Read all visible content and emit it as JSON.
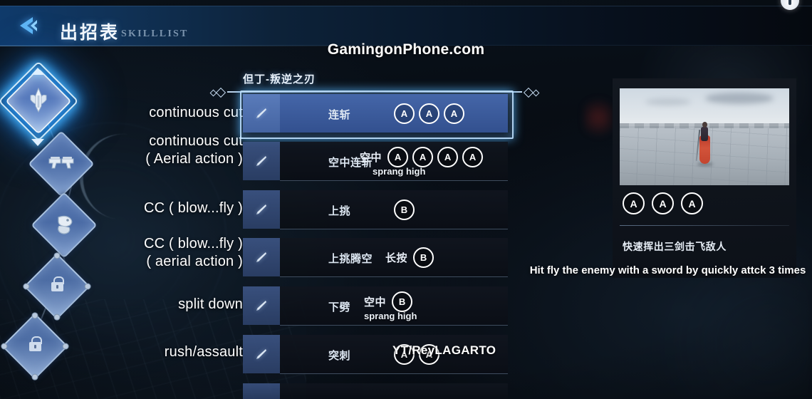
{
  "header": {
    "back_icon": "back-chevron-icon",
    "title_cn": "出招表",
    "title_en": "SKILLLIST",
    "corner_icon": "circle-info-icon"
  },
  "watermark": {
    "site": "GamingonPhone.com",
    "channel": "YT/ReyLAGARTO"
  },
  "weapon_rail": {
    "items": [
      {
        "name": "sword-weapon-icon",
        "state": "selected",
        "locked": false
      },
      {
        "name": "dual-pistols-weapon-icon",
        "state": "normal",
        "locked": false
      },
      {
        "name": "gauntlet-weapon-icon",
        "state": "normal",
        "locked": false
      },
      {
        "name": "locked-weapon-slot-icon",
        "state": "locked",
        "locked": true
      },
      {
        "name": "locked-weapon-slot-icon",
        "state": "locked",
        "locked": true
      }
    ]
  },
  "skill_panel": {
    "section_title": "但丁-叛逆之刃",
    "rows": [
      {
        "annotation": [
          "continuous cut"
        ],
        "command_cn": "连斩",
        "prefix": "",
        "keys": [
          "A",
          "A",
          "A"
        ],
        "note": "",
        "selected": true
      },
      {
        "annotation": [
          "continuous cut",
          "( Aerial action )"
        ],
        "command_cn": "空中连斩",
        "prefix": "空中",
        "keys": [
          "A",
          "A",
          "A",
          "A"
        ],
        "note": "sprang high",
        "selected": false
      },
      {
        "annotation": [
          "CC ( blow...fly )"
        ],
        "command_cn": "上挑",
        "prefix": "",
        "keys": [
          "B"
        ],
        "note": "",
        "selected": false
      },
      {
        "annotation": [
          "CC ( blow...fly )",
          "( aerial action )"
        ],
        "command_cn": "上挑腾空",
        "prefix": "长按",
        "keys": [
          "B"
        ],
        "note": "",
        "selected": false
      },
      {
        "annotation": [
          "split down"
        ],
        "command_cn": "下劈",
        "prefix": "空中",
        "keys": [
          "B"
        ],
        "note": "sprang high",
        "selected": false
      },
      {
        "annotation": [
          "rush/assault"
        ],
        "command_cn": "突刺",
        "prefix": "",
        "keys": [
          "A",
          "A"
        ],
        "note": "",
        "selected": false
      }
    ]
  },
  "detail_panel": {
    "preview_name": "skill-video-preview",
    "keys": [
      "A",
      "A",
      "A"
    ],
    "description_cn": "快速挥出三剑击飞敌人",
    "description_en": "Hit fly the enemy with a sword by quickly attck 3 times"
  }
}
